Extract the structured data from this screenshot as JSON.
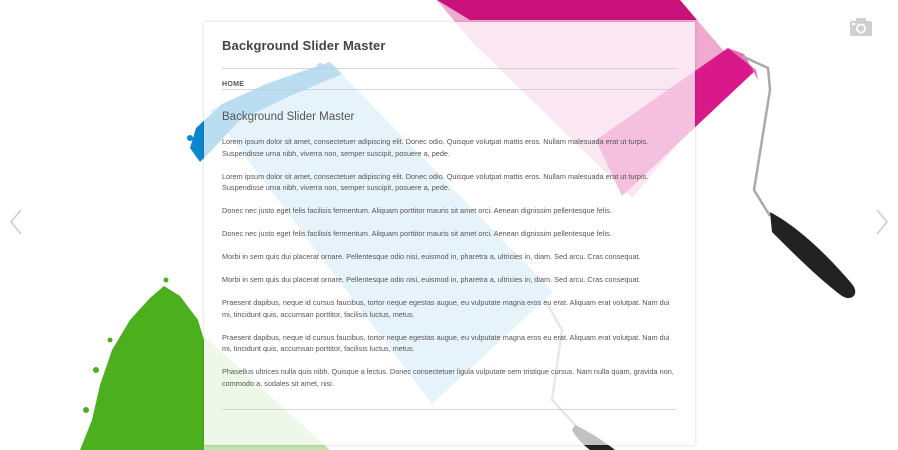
{
  "site": {
    "title": "Background Slider Master"
  },
  "nav": {
    "items": [
      {
        "label": "HOME"
      }
    ]
  },
  "entry": {
    "title": "Background Slider Master",
    "paragraphs": [
      "Lorem ipsum dolor sit amet, consectetuer adipiscing elit. Donec odio. Quisque volutpat mattis eros. Nullam malesuada erat ut turpis. Suspendisse urna nibh, viverra non, semper suscipit, posuere a, pede.",
      "Lorem ipsum dolor sit amet, consectetuer adipiscing elit. Donec odio. Quisque volutpat mattis eros. Nullam malesuada erat ut turpis. Suspendisse urna nibh, viverra non, semper suscipit, posuere a, pede.",
      "Donec nec justo eget felis facilisis fermentum. Aliquam porttitor mauris sit amet orci. Aenean dignissim pellentesque felis.",
      "Donec nec justo eget felis facilisis fermentum. Aliquam porttitor mauris sit amet orci. Aenean dignissim pellentesque felis.",
      "Morbi in sem quis dui placerat ornare. Pellentesque odio nisi, euismod in, pharetra a, ultricies in, diam. Sed arcu. Cras consequat.",
      "Morbi in sem quis dui placerat ornare. Pellentesque odio nisi, euismod in, pharetra a, ultricies in, diam. Sed arcu. Cras consequat.",
      "Praesent dapibus, neque id cursus faucibus, tortor neque egestas augue, eu vulputate magna eros eu erat. Aliquam erat volutpat. Nam dui mi, tincidunt quis, accumsan porttitor, facilisis luctus, metus.",
      "Praesent dapibus, neque id cursus faucibus, tortor neque egestas augue, eu vulputate magna eros eu erat. Aliquam erat volutpat. Nam dui mi, tincidunt quis, accumsan porttitor, facilisis luctus, metus.",
      "Phasellus ultrices nulla quis nibh. Quisque a lectus. Donec consectetuer ligula vulputate sem tristique cursus. Nam nulla quam, gravida non, commodo a, sodales sit amet, nisi."
    ]
  },
  "slider": {
    "prev_icon": "chevron-left-icon",
    "next_icon": "chevron-right-icon",
    "camera_icon": "camera-icon"
  },
  "colors": {
    "magenta": "#d0177f",
    "pink": "#f0a9cf",
    "blue": "#0a87cf",
    "light_blue": "#a8d4f0",
    "green": "#4caf1e",
    "light_green": "#bfe4ad",
    "handle": "#222222"
  }
}
